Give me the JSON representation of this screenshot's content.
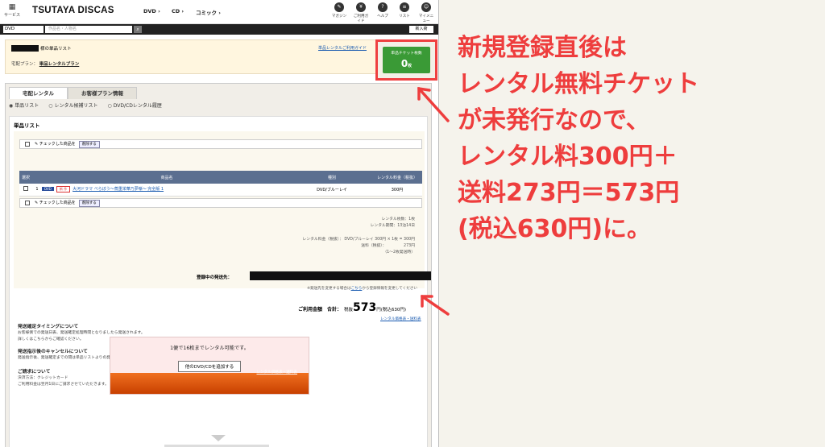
{
  "header": {
    "service_label": "サービス",
    "logo": "TSUTAYA DISCAS",
    "categories": [
      "DVD ›",
      "CD ›",
      "コミック ›"
    ],
    "icons": [
      {
        "name": "magazine-icon",
        "label": "マガジン"
      },
      {
        "name": "guide-icon",
        "label": "ご利用ガイド"
      },
      {
        "name": "help-icon",
        "label": "ヘルプ"
      },
      {
        "name": "list-icon",
        "label": "リスト"
      },
      {
        "name": "mymenu-icon",
        "label": "マイメニュー"
      }
    ]
  },
  "search": {
    "category": "DVD",
    "placeholder": "作品名・人物名",
    "right": "新入荷"
  },
  "plan": {
    "list_title": "様の単品リスト",
    "plan_label": "宅配プラン：",
    "plan_value": "単品レンタルプラン",
    "link": "単品レンタルご利用ガイド"
  },
  "ticket": {
    "label": "単品チケット枚数",
    "count": "0",
    "unit": "枚"
  },
  "tabs": [
    "宅配レンタル",
    "お客様プラン情報"
  ],
  "radios": [
    "単品リスト",
    "レンタル候補リスト",
    "DVD/CDレンタル履歴"
  ],
  "list": {
    "title": "単品リスト",
    "check_action": "チェックした商品を",
    "delete": "削除する",
    "headers": [
      "選択",
      "",
      "商品名",
      "種別",
      "レンタル料金（税抜）"
    ],
    "rows": [
      {
        "no": "1",
        "badge1": "DVD",
        "badge2": "新 作",
        "title": "大河ドラマ べらぼう〜蔦重栄華乃夢噺〜 完全版 1",
        "type": "DVD/ブルーレイ",
        "price": "300円"
      }
    ]
  },
  "summary": {
    "count": "レンタル枚数：1枚",
    "period": "レンタル期間：13泊14日",
    "fee_line": "レンタル料金（税抜）： DVD/ブルーレイ 300円 × 1枚 = 300円",
    "ship_label": "送料（税抜）：",
    "ship_value": "273円",
    "ship_note": "（1〜2枚発送時）",
    "dest_label": "登録中の発送先：",
    "dest_note_pre": "※発送先を変更する場合は",
    "dest_note_link": "こちら",
    "dest_note_post": "から登録情報を変更してください",
    "total_label": "ご利用金額　合計：",
    "tax_label": "税抜",
    "total_value": "573",
    "total_tax": "円(税込630円)",
    "price_link": "レンタル価格表・送料表"
  },
  "info": [
    {
      "title": "発送確定タイミングについて",
      "lines": [
        "お客様側での発送日表、発送確定処理時間となりましたら発送されます。",
        "詳しくはこちらからご確認ください。"
      ]
    },
    {
      "title": "発送指示後のキャンセルについて",
      "lines": [
        "発送指示後、発送確定までの間は単品リストよりの発送キャンセルが可能です。"
      ]
    },
    {
      "title": "ご請求について",
      "lines": [
        "決済方法：クレジットカード",
        "ご利用料金は翌月1日にご請求させていただきます。"
      ]
    }
  ],
  "cta": {
    "text": "1便で16枚までレンタル可能です。",
    "button": "他のDVD/CDを追加する",
    "link": "レンタル価格表・送料表"
  },
  "annotation": [
    "新規登録直後は",
    "レンタル無料チケット",
    "が未発行なので、",
    "レンタル料300円＋",
    "送料273円＝573円",
    "(税込630円)に。"
  ],
  "colors": {
    "accent_red": "#ee3d3d",
    "ticket_green": "#3a9a36",
    "table_header": "#5b6f90"
  }
}
